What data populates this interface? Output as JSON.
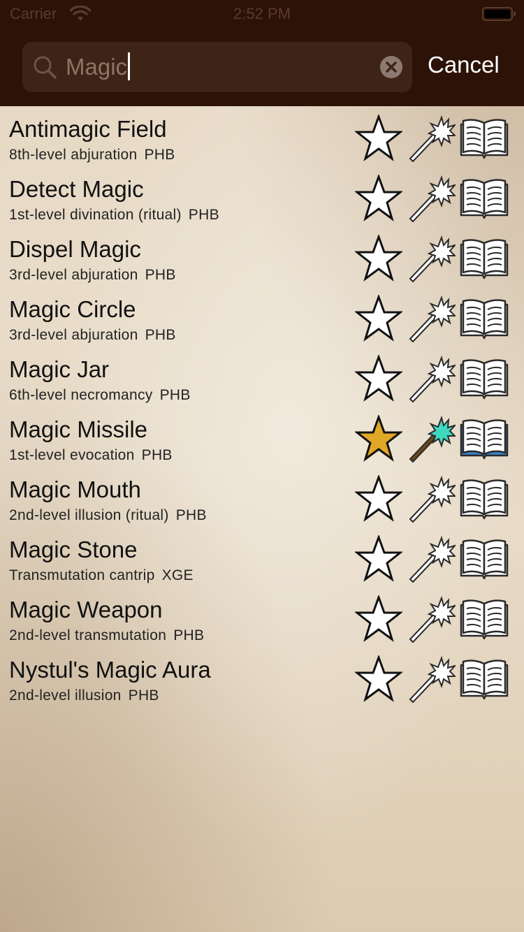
{
  "status_bar": {
    "carrier": "Carrier",
    "time": "2:52 PM"
  },
  "search": {
    "value": "Magic",
    "cancel_label": "Cancel"
  },
  "spells": [
    {
      "name": "Antimagic Field",
      "level_school": "8th-level abjuration",
      "source": "PHB",
      "favorite": false,
      "prepared": false,
      "known": false
    },
    {
      "name": "Detect Magic",
      "level_school": "1st-level divination (ritual)",
      "source": "PHB",
      "favorite": false,
      "prepared": false,
      "known": false
    },
    {
      "name": "Dispel Magic",
      "level_school": "3rd-level abjuration",
      "source": "PHB",
      "favorite": false,
      "prepared": false,
      "known": false
    },
    {
      "name": "Magic Circle",
      "level_school": "3rd-level abjuration",
      "source": "PHB",
      "favorite": false,
      "prepared": false,
      "known": false
    },
    {
      "name": "Magic Jar",
      "level_school": "6th-level necromancy",
      "source": "PHB",
      "favorite": false,
      "prepared": false,
      "known": false
    },
    {
      "name": "Magic Missile",
      "level_school": "1st-level evocation",
      "source": "PHB",
      "favorite": true,
      "prepared": true,
      "known": true
    },
    {
      "name": "Magic Mouth",
      "level_school": "2nd-level illusion (ritual)",
      "source": "PHB",
      "favorite": false,
      "prepared": false,
      "known": false
    },
    {
      "name": "Magic Stone",
      "level_school": "Transmutation cantrip",
      "source": "XGE",
      "favorite": false,
      "prepared": false,
      "known": false
    },
    {
      "name": "Magic Weapon",
      "level_school": "2nd-level transmutation",
      "source": "PHB",
      "favorite": false,
      "prepared": false,
      "known": false
    },
    {
      "name": "Nystul's Magic Aura",
      "level_school": "2nd-level illusion",
      "source": "PHB",
      "favorite": false,
      "prepared": false,
      "known": false
    }
  ],
  "icons": {
    "favorite": "star-icon",
    "prepared": "magic-wand-icon",
    "known": "spellbook-icon",
    "search": "search-icon",
    "clear": "clear-icon"
  },
  "colors": {
    "header_background": "#2c1207",
    "search_field": "#3e2417",
    "favorite_active": "#e0a826",
    "prepared_active": "#3fd9c2",
    "known_active": "#3a7fc4",
    "inactive_fill": "#ffffff"
  }
}
